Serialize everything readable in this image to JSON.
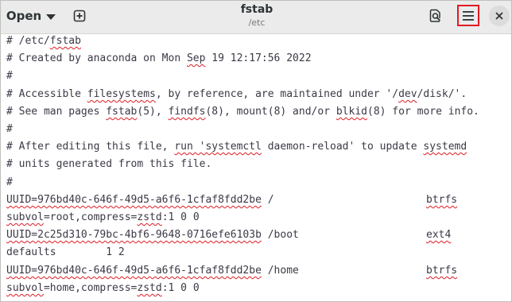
{
  "header": {
    "open_label": "Open",
    "title": "fstab",
    "subtitle": "/etc"
  },
  "icons": {
    "open_dropdown": "chevron-down-icon",
    "new_tab": "new-tab-icon",
    "search": "search-icon",
    "menu": "hamburger-menu-icon",
    "close": "close-icon"
  },
  "colors": {
    "highlight_box": "#e01b24",
    "spellcheck_underline": "#e01b24"
  },
  "lines": [
    {
      "text": "# /etc/fstab",
      "segments": [
        {
          "t": "# /etc/"
        },
        {
          "t": "fstab",
          "u": true
        }
      ]
    },
    {
      "text": "# Created by anaconda on Mon Sep 19 12:17:56 2022",
      "segments": [
        {
          "t": "# Created by anaconda on Mon "
        },
        {
          "t": "Sep",
          "u": true
        },
        {
          "t": " 19 12:17:56 2022"
        }
      ]
    },
    {
      "text": "#",
      "segments": [
        {
          "t": "#"
        }
      ]
    },
    {
      "text": "# Accessible filesystems, by reference, are maintained under '/dev/disk/'.",
      "segments": [
        {
          "t": "# Accessible "
        },
        {
          "t": "filesystems",
          "u": true
        },
        {
          "t": ", by reference, are maintained under '/"
        },
        {
          "t": "dev",
          "u": true
        },
        {
          "t": "/disk/'."
        }
      ]
    },
    {
      "text": "# See man pages fstab(5), findfs(8), mount(8) and/or blkid(8) for more info.",
      "segments": [
        {
          "t": "# See man pages "
        },
        {
          "t": "fstab",
          "u": true
        },
        {
          "t": "(5), "
        },
        {
          "t": "findfs",
          "u": true
        },
        {
          "t": "(8), mount(8) and/or "
        },
        {
          "t": "blkid",
          "u": true
        },
        {
          "t": "(8) for more info."
        }
      ]
    },
    {
      "text": "#",
      "segments": [
        {
          "t": "#"
        }
      ]
    },
    {
      "text": "# After editing this file, run 'systemctl daemon-reload' to update systemd",
      "segments": [
        {
          "t": "# After editing this file, "
        },
        {
          "t": "run 'systemctl",
          "u": true
        },
        {
          "t": " daemon-reload' to update "
        },
        {
          "t": "systemd",
          "u": true
        }
      ]
    },
    {
      "text": "# units generated from this file.",
      "segments": [
        {
          "t": "# units generated from this file."
        }
      ]
    },
    {
      "text": "#",
      "segments": [
        {
          "t": "#"
        }
      ]
    },
    {
      "text": "UUID=976bd40c-646f-49d5-a6f6-1cfaf8fdd2be /",
      "segments": [
        {
          "t": "UUID=976bd40c-646f-49d5-a6f6-1cfaf8fdd2be",
          "u": true
        },
        {
          "t": " /"
        }
      ],
      "col2": {
        "t": "btrfs",
        "u": true
      }
    },
    {
      "text": "subvol=root,compress=zstd:1 0 0",
      "segments": [
        {
          "t": "subvol",
          "u": true
        },
        {
          "t": "=root,compress="
        },
        {
          "t": "zstd",
          "u": true
        },
        {
          "t": ":1 0 0"
        }
      ]
    },
    {
      "text": "UUID=2c25d310-79bc-4bf6-9648-0716efe6103b /boot",
      "segments": [
        {
          "t": "UUID=2c25d310-79bc-4bf6-9648-0716efe6103b",
          "u": true
        },
        {
          "t": " /boot"
        }
      ],
      "col2": {
        "t": "ext4",
        "u": true
      }
    },
    {
      "text": "defaults        1 2",
      "segments": [
        {
          "t": "defaults        1 2"
        }
      ]
    },
    {
      "text": "UUID=976bd40c-646f-49d5-a6f6-1cfaf8fdd2be /home",
      "segments": [
        {
          "t": "UUID=976bd40c-646f-49d5-a6f6-1cfaf8fdd2be",
          "u": true
        },
        {
          "t": " /home"
        }
      ],
      "col2": {
        "t": "btrfs",
        "u": true
      }
    },
    {
      "text": "subvol=home,compress=zstd:1 0 0",
      "segments": [
        {
          "t": "subvol",
          "u": true
        },
        {
          "t": "=home,compress="
        },
        {
          "t": "zstd",
          "u": true
        },
        {
          "t": ":1 0 0"
        }
      ]
    }
  ]
}
